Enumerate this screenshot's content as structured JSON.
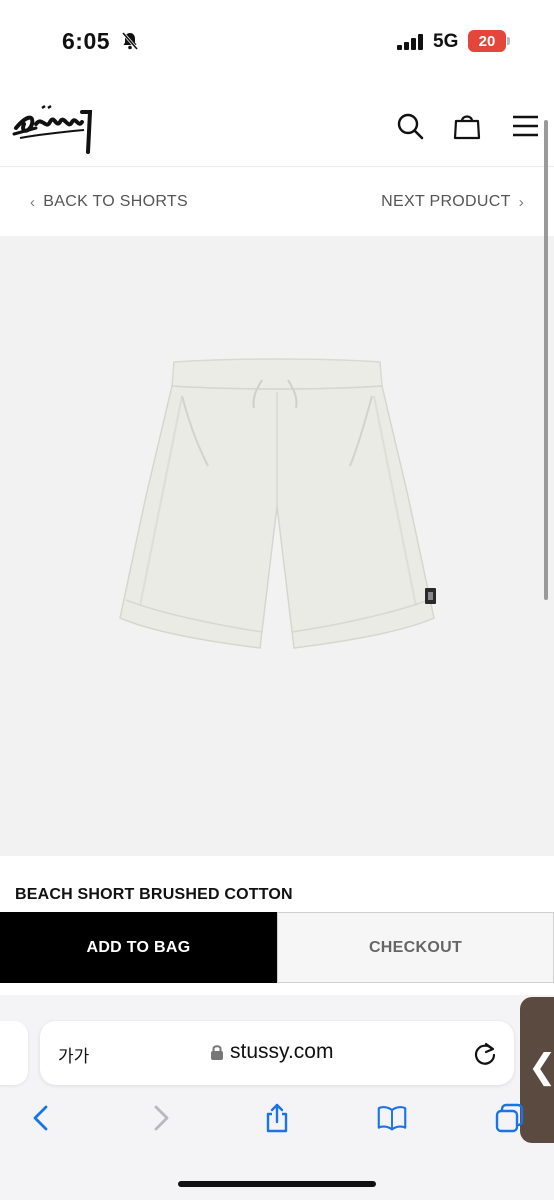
{
  "status_bar": {
    "time": "6:05",
    "network": "5G",
    "battery": "20",
    "battery_color": "#e5463b"
  },
  "header": {
    "logo": "Stüssy",
    "icons": [
      "search-icon",
      "shopping-bag-icon",
      "menu-icon"
    ]
  },
  "nav": {
    "back_label": "BACK TO SHORTS",
    "next_label": "NEXT PRODUCT"
  },
  "product": {
    "title": "BEACH SHORT BRUSHED COTTON",
    "image": "white shorts"
  },
  "actions": {
    "add_to_bag": "ADD TO BAG",
    "checkout": "CHECKOUT"
  },
  "browser": {
    "aa_label": "가가",
    "url": "stussy.com",
    "toolbar_icons": [
      "back-icon",
      "forward-icon",
      "share-icon",
      "bookmarks-icon",
      "tabs-icon"
    ]
  }
}
